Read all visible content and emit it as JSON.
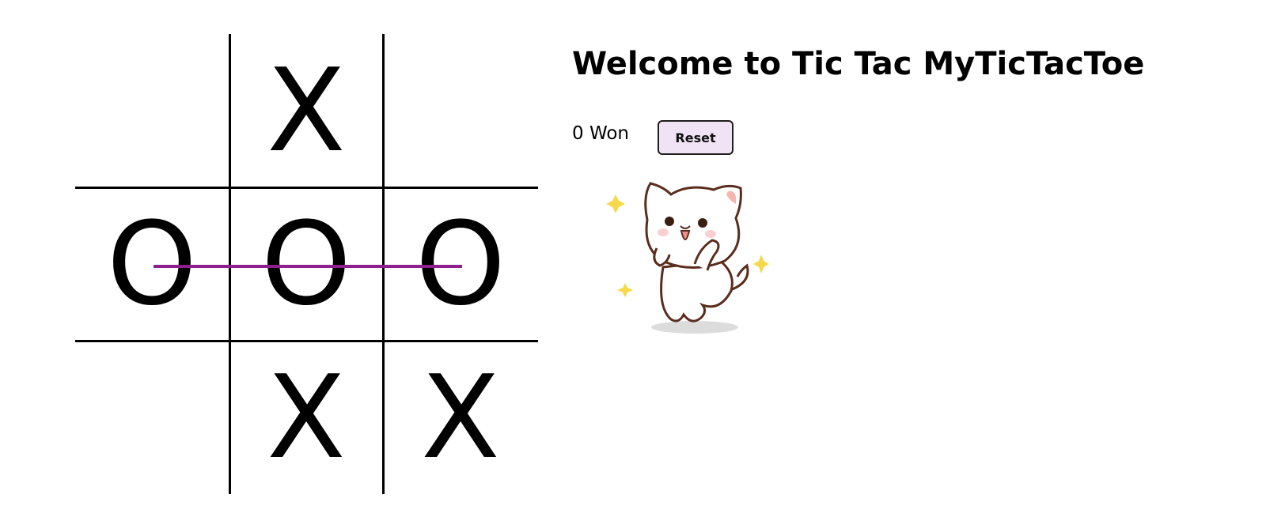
{
  "game": {
    "title": "Welcome to Tic Tac MyTicTacToe",
    "score": {
      "wins": 0,
      "label": "0 Won"
    },
    "reset_label": "Reset",
    "board": [
      [
        "",
        "X",
        ""
      ],
      [
        "O",
        "O",
        "O"
      ],
      [
        "",
        "X",
        "X"
      ]
    ],
    "winning_row": 1,
    "win_line_color": "#8e1f8e",
    "reset_bg": "#efe3f5",
    "mascot": "dancing-cat-icon"
  }
}
